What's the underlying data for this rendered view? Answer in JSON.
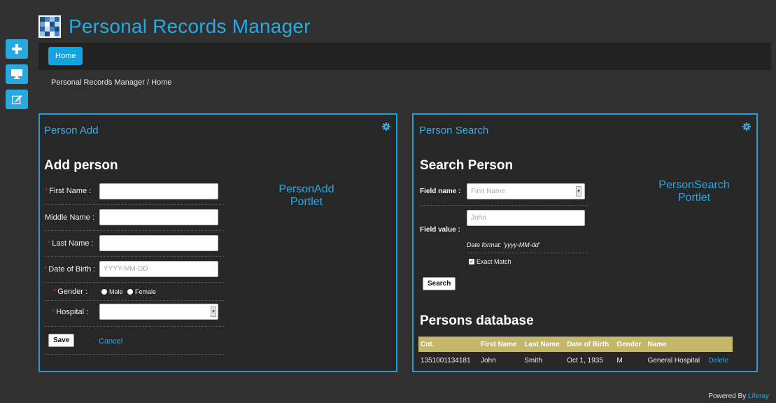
{
  "app": {
    "title": "Personal Records Manager"
  },
  "dock": [
    {
      "icon": "plus-icon"
    },
    {
      "icon": "monitor-icon"
    },
    {
      "icon": "edit-icon"
    }
  ],
  "nav": {
    "home": "Home"
  },
  "breadcrumb": "Personal Records Manager / Home",
  "person_add": {
    "portlet_title": "Person Add",
    "heading": "Add person",
    "watermark_line1": "PersonAdd",
    "watermark_line2": "Portlet",
    "first_name_label": "First Name :",
    "middle_name_label": "Middle Name :",
    "last_name_label": "Last Name :",
    "dob_label": "Date of Birth :",
    "dob_placeholder": "YYYY-MM-DD",
    "gender_label": "Gender :",
    "gender_male": "Male",
    "gender_female": "Female",
    "hospital_label": "Hospital :",
    "save": "Save",
    "cancel": "Cancel"
  },
  "person_search": {
    "portlet_title": "Person Search",
    "heading": "Search Person",
    "watermark_line1": "PersonSearch",
    "watermark_line2": "Portlet",
    "field_name_label": "Field name :",
    "field_name_value": "First Name",
    "field_value_label": "Field value :",
    "field_value": "John",
    "date_hint": "Date format: 'yyyy-MM-dd'",
    "exact_match": "Exact Match",
    "search": "Search",
    "db_heading": "Persons database",
    "columns": [
      "Cnt.",
      "First Name",
      "Last Name",
      "Date of Birth",
      "Gender",
      "Name"
    ],
    "rows": [
      {
        "cnt": "1351001134181",
        "first": "John",
        "last": "Smith",
        "dob": "Oct 1, 1935",
        "gender": "M",
        "hospital": "General Hospital",
        "action": "Delete"
      }
    ]
  },
  "footer": {
    "powered": "Powered By",
    "brand": "Liferay"
  },
  "colors": {
    "accent": "#29a9e0",
    "background": "#303030",
    "table_header": "#c4b76a"
  }
}
